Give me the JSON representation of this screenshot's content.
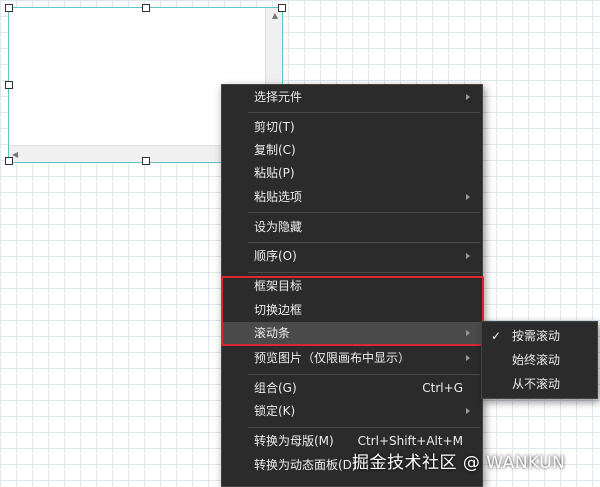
{
  "context_menu": {
    "items": [
      {
        "label": "选择元件",
        "shortcut": "",
        "submenu": true
      },
      {
        "label": "剪切(T)",
        "shortcut": "",
        "submenu": false
      },
      {
        "label": "复制(C)",
        "shortcut": "",
        "submenu": false
      },
      {
        "label": "粘贴(P)",
        "shortcut": "",
        "submenu": false
      },
      {
        "label": "粘贴选项",
        "shortcut": "",
        "submenu": true
      },
      {
        "label": "设为隐藏",
        "shortcut": "",
        "submenu": false
      },
      {
        "label": "顺序(O)",
        "shortcut": "",
        "submenu": true
      },
      {
        "label": "框架目标",
        "shortcut": "",
        "submenu": false
      },
      {
        "label": "切换边框",
        "shortcut": "",
        "submenu": false
      },
      {
        "label": "滚动条",
        "shortcut": "",
        "submenu": true,
        "active": true
      },
      {
        "label": "预览图片（仅限画布中显示）",
        "shortcut": "",
        "submenu": true
      },
      {
        "label": "组合(G)",
        "shortcut": "Ctrl+G",
        "submenu": false
      },
      {
        "label": "锁定(K)",
        "shortcut": "",
        "submenu": true
      },
      {
        "label": "转换为母版(M)",
        "shortcut": "Ctrl+Shift+Alt+M",
        "submenu": false
      },
      {
        "label": "转换为动态面板(D)",
        "shortcut": "",
        "submenu": false
      }
    ]
  },
  "scrollbar_submenu": {
    "items": [
      {
        "label": "按需滚动",
        "checked": true
      },
      {
        "label": "始终滚动",
        "checked": false
      },
      {
        "label": "从不滚动",
        "checked": false
      }
    ]
  },
  "watermark": "掘金技术社区 @ WANKUN",
  "colors": {
    "menu_bg": "#2b2b2b",
    "menu_active": "#4b4b4b",
    "highlight_box": "#d9282f",
    "frame_border": "#5fc6c9",
    "grid": "#dfe7ee"
  }
}
